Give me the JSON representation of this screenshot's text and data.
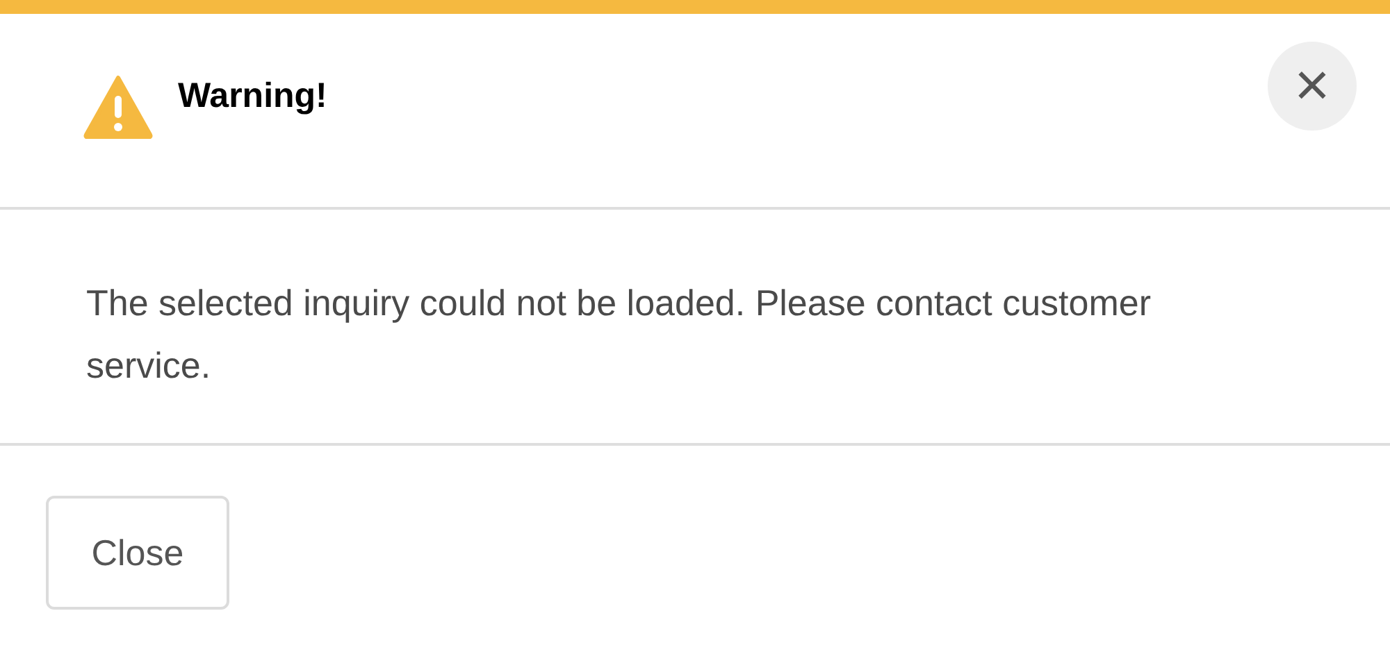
{
  "dialog": {
    "title": "Warning!",
    "close_icon": "×",
    "message": "The selected inquiry could not be loaded. Please contact customer service.",
    "buttons": [
      "Close"
    ]
  }
}
